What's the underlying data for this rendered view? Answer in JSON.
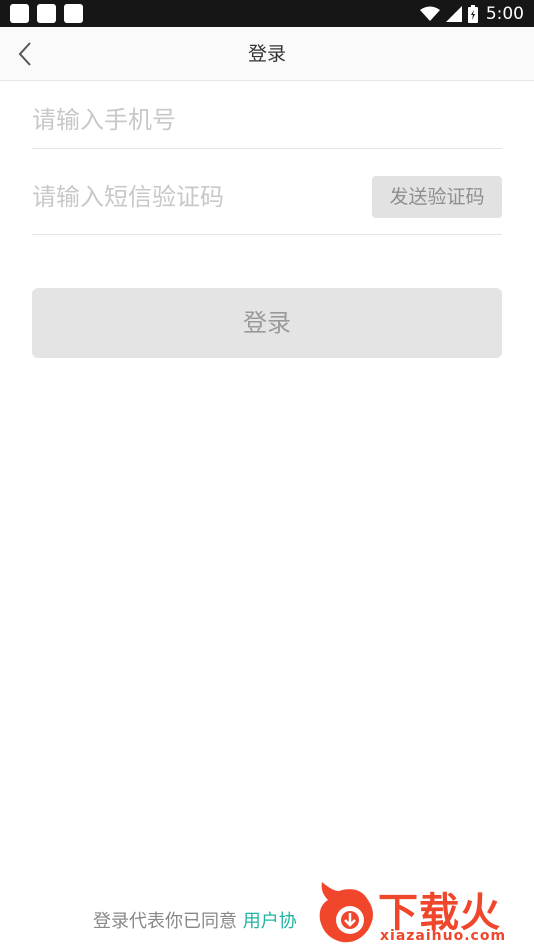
{
  "status_bar": {
    "time": "5:00"
  },
  "nav": {
    "title": "登录"
  },
  "form": {
    "phone_placeholder": "请输入手机号",
    "code_placeholder": "请输入短信验证码",
    "send_code_label": "发送验证码",
    "login_label": "登录"
  },
  "footer": {
    "agreement_prefix": "登录代表你已同意",
    "agreement_link": "用户协"
  },
  "watermark": {
    "name": "下载火",
    "site": "xiazaihuo.com"
  },
  "colors": {
    "link": "#21b4a3",
    "disabled_bg": "#e4e4e4",
    "watermark": "#f0462c"
  }
}
